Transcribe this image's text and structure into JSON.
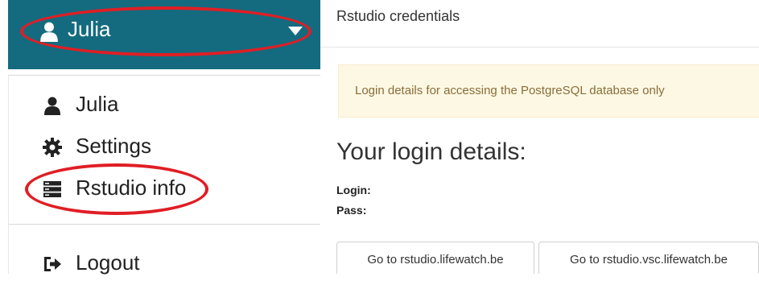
{
  "user_menu": {
    "username": "Julia",
    "icons": {
      "user": "user-icon",
      "caret": "caret-down-icon"
    },
    "bar_color": "#146b7f"
  },
  "menu": {
    "items": [
      {
        "label": "Julia",
        "icon": "user-icon"
      },
      {
        "label": "Settings",
        "icon": "gear-icon"
      },
      {
        "label": "Rstudio info",
        "icon": "server-icon"
      },
      {
        "label": "Logout",
        "icon": "sign-out-icon"
      }
    ]
  },
  "highlight_color": "#e01e24",
  "panel": {
    "title": "Rstudio credentials",
    "alert": "Login details for accessing the PostgreSQL database only",
    "heading": "Your login details:",
    "login_label": "Login:",
    "pass_label": "Pass:",
    "buttons": [
      {
        "label": "Go to rstudio.lifewatch.be"
      },
      {
        "label": "Go to rstudio.vsc.lifewatch.be"
      }
    ]
  }
}
